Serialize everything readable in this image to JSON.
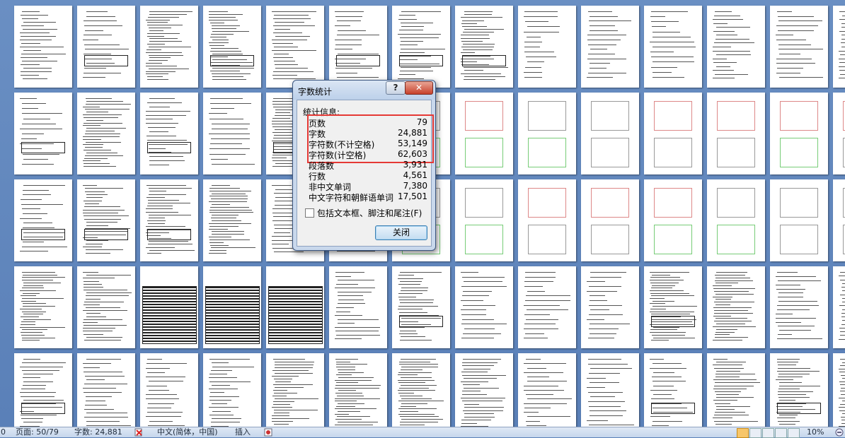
{
  "dialog": {
    "title": "字数统计",
    "help_label": "?",
    "close_x_label": "✕",
    "section_label": "统计信息:",
    "stats": [
      {
        "label": "页数",
        "value": "79"
      },
      {
        "label": "字数",
        "value": "24,881"
      },
      {
        "label": "字符数(不计空格)",
        "value": "53,149"
      },
      {
        "label": "字符数(计空格)",
        "value": "62,603"
      },
      {
        "label": "段落数",
        "value": "3,931"
      },
      {
        "label": "行数",
        "value": "4,561"
      },
      {
        "label": "非中文单词",
        "value": "7,380"
      },
      {
        "label": "中文字符和朝鲜语单词",
        "value": "17,501"
      }
    ],
    "checkbox_label": "包括文本框、脚注和尾注(F)",
    "checkbox_checked": false,
    "close_button_label": "关闭"
  },
  "statusbar": {
    "left_cut": "0",
    "page": "页面: 50/79",
    "words": "字数: 24,881",
    "language": "中文(简体，中国)",
    "mode": "插入",
    "zoom": "10%"
  },
  "colors": {
    "background": "#5b82b8",
    "highlight": "#e53935",
    "close_x": "#c7402a"
  },
  "thumbnails": {
    "rows": 5,
    "cols": 14,
    "icon": "document-page-thumbnail"
  }
}
